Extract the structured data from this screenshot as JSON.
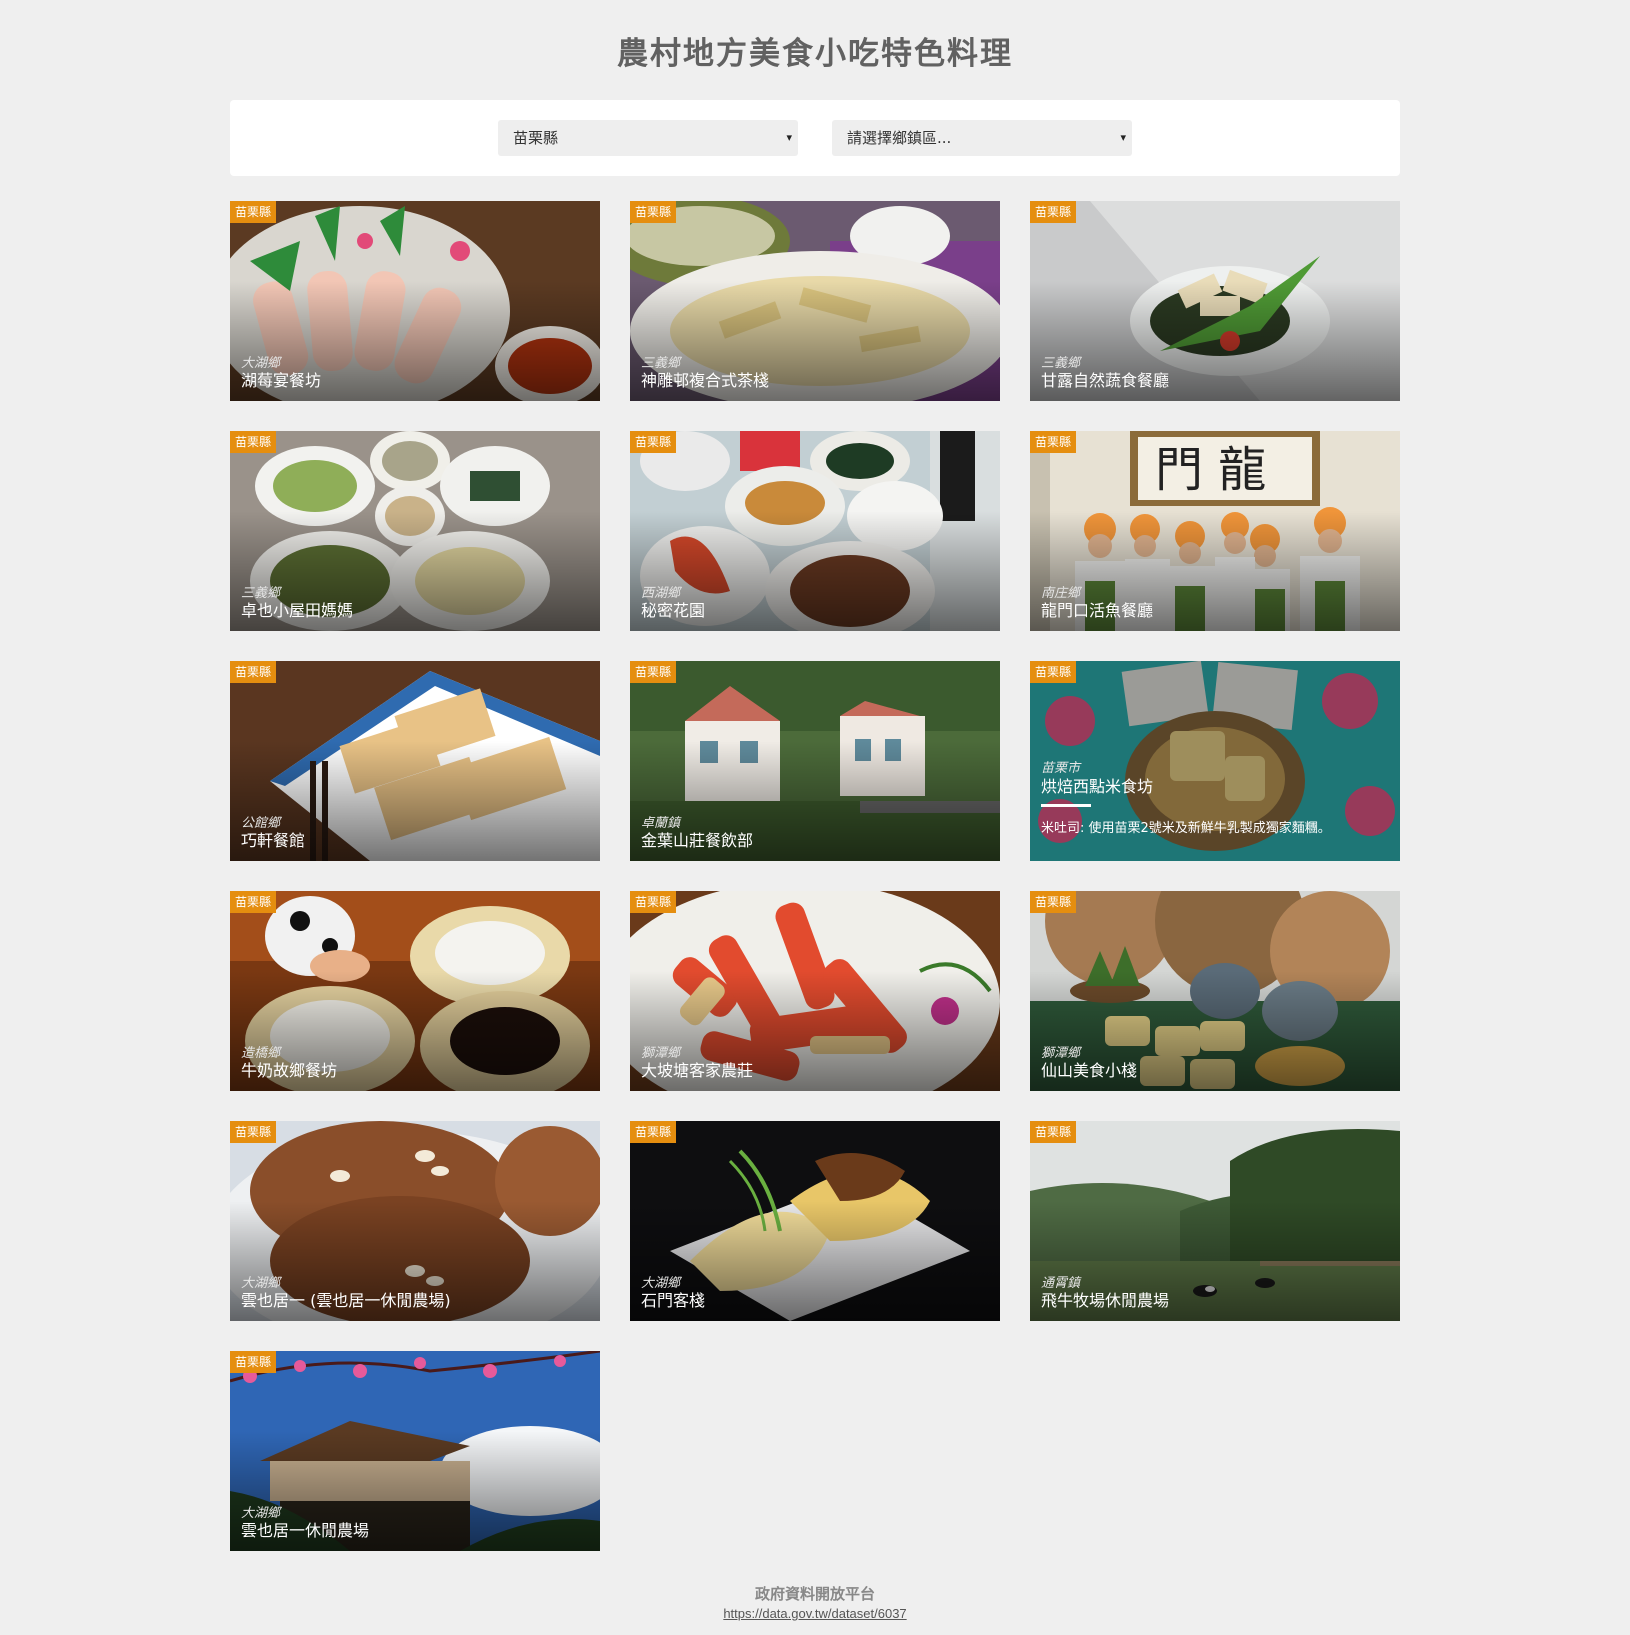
{
  "page": {
    "title": "農村地方美食小吃特色料理"
  },
  "filters": {
    "county": {
      "selected": "苗栗縣",
      "arrow": "▾"
    },
    "town": {
      "selected": "請選擇鄉鎮區...",
      "arrow": "▾"
    }
  },
  "cards": [
    {
      "county": "苗栗縣",
      "town": "大湖鄉",
      "name": "湖莓宴餐坊"
    },
    {
      "county": "苗栗縣",
      "town": "三義鄉",
      "name": "神雕邨複合式茶棧"
    },
    {
      "county": "苗栗縣",
      "town": "三義鄉",
      "name": "甘露自然蔬食餐廳"
    },
    {
      "county": "苗栗縣",
      "town": "三義鄉",
      "name": "卓也小屋田媽媽"
    },
    {
      "county": "苗栗縣",
      "town": "西湖鄉",
      "name": "秘密花園"
    },
    {
      "county": "苗栗縣",
      "town": "南庄鄉",
      "name": "龍門口活魚餐廳"
    },
    {
      "county": "苗栗縣",
      "town": "公館鄉",
      "name": "巧軒餐館"
    },
    {
      "county": "苗栗縣",
      "town": "卓蘭鎮",
      "name": "金葉山莊餐飲部"
    },
    {
      "county": "苗栗縣",
      "town": "苗栗市",
      "name": "烘焙西點米食坊",
      "desc": "米吐司: 使用苗栗2號米及新鮮牛乳製成獨家麵糰。"
    },
    {
      "county": "苗栗縣",
      "town": "造橋鄉",
      "name": "牛奶故鄉餐坊"
    },
    {
      "county": "苗栗縣",
      "town": "獅潭鄉",
      "name": "大坡塘客家農莊"
    },
    {
      "county": "苗栗縣",
      "town": "獅潭鄉",
      "name": "仙山美食小棧"
    },
    {
      "county": "苗栗縣",
      "town": "大湖鄉",
      "name": "雲也居一 (雲也居一休閒農場)"
    },
    {
      "county": "苗栗縣",
      "town": "大湖鄉",
      "name": "石門客棧"
    },
    {
      "county": "苗栗縣",
      "town": "通霄鎮",
      "name": "飛牛牧場休閒農場"
    },
    {
      "county": "苗栗縣",
      "town": "大湖鄉",
      "name": "雲也居一休閒農場"
    }
  ],
  "footer": {
    "source": "政府資料開放平台",
    "link": "https://data.gov.tw/dataset/6037"
  }
}
